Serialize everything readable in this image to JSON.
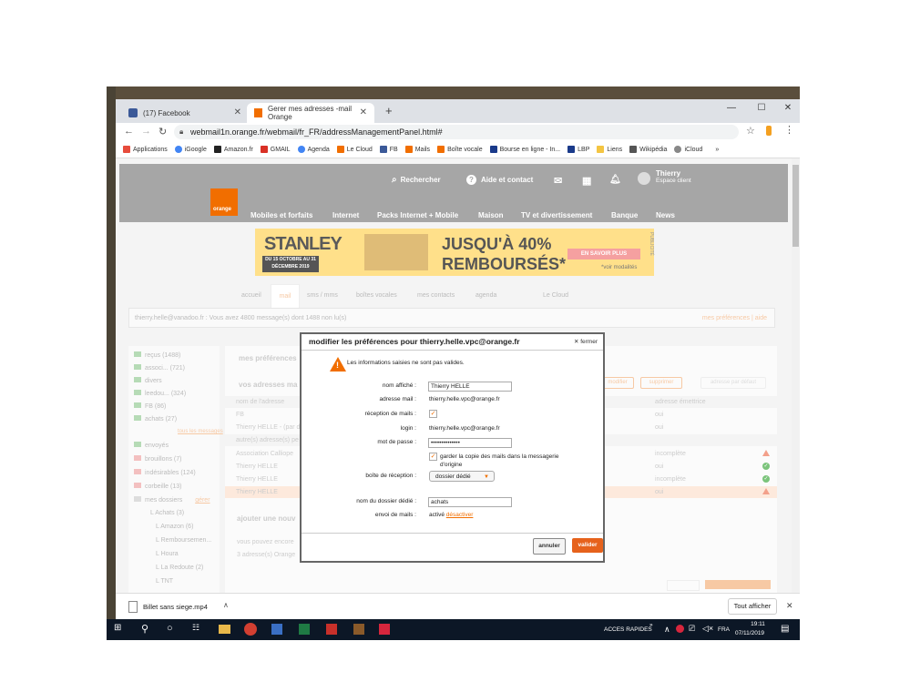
{
  "browser": {
    "tabs": [
      {
        "label": "(17) Facebook",
        "close": "✕"
      },
      {
        "label": "Gerer mes adresses -mail Orange",
        "close": "✕"
      }
    ],
    "new_tab": "+",
    "window": {
      "minimize": "—",
      "maximize": "☐",
      "close": "✕"
    },
    "url": "webmail1n.orange.fr/webmail/fr_FR/addressManagementPanel.html#",
    "bookmarks": [
      {
        "label": "Applications",
        "color": "#e74c3c"
      },
      {
        "label": "iGoogle",
        "color": "#4285f4"
      },
      {
        "label": "Amazon.fr",
        "color": "#222222"
      },
      {
        "label": "GMAIL",
        "color": "#d93025"
      },
      {
        "label": "Agenda",
        "color": "#4285f4"
      },
      {
        "label": "Le Cloud",
        "color": "#f16e00"
      },
      {
        "label": "FB",
        "color": "#3b5998"
      },
      {
        "label": "Mails",
        "color": "#f16e00"
      },
      {
        "label": "Boîte vocale",
        "color": "#f16e00"
      },
      {
        "label": "Bourse en ligne - In...",
        "color": "#1a3a8a"
      },
      {
        "label": "LBP",
        "color": "#1a3a8a"
      },
      {
        "label": "Liens",
        "color": "#f4c542"
      },
      {
        "label": "Wikipédia",
        "color": "#555555"
      },
      {
        "label": "iCloud",
        "color": "#888888"
      }
    ],
    "more_bookmarks": "»"
  },
  "header": {
    "search": "Rechercher",
    "help": "Aide et contact",
    "user_name": "Thierry",
    "user_sub": "Espace client",
    "logo": "orange",
    "nav": [
      "Mobiles et forfaits",
      "Internet",
      "Packs Internet + Mobile",
      "Maison",
      "TV et divertissement",
      "Banque",
      "News"
    ]
  },
  "banner": {
    "brand": "STANLEY",
    "dates": "DU 15 OCTOBRE AU 31 DÉCEMBRE 2019",
    "promo_line1": "JUSQU'À 40%",
    "promo_line2": "REMBOURSÉS*",
    "cta": "EN SAVOIR PLUS",
    "more": "*voir modalités",
    "pub": "PUBLICITÉ"
  },
  "mail_tabs": [
    "accueil",
    "mail",
    "sms / mms",
    "boîtes vocales",
    "mes contacts",
    "agenda",
    "Le Cloud"
  ],
  "info_bar": {
    "text": "thierry.helle@vanadoo.fr : Vous avez 4800 message(s) dont 1488 non lu(s)",
    "links": "mes préférences | aide"
  },
  "folders": [
    {
      "label": "reçus",
      "count": "(1488)"
    },
    {
      "label": "associ...",
      "count": "(721)"
    },
    {
      "label": "divers",
      "count": ""
    },
    {
      "label": "leedou...",
      "count": "(324)"
    },
    {
      "label": "FB",
      "count": "(86)"
    },
    {
      "label": "achats",
      "count": "(27)"
    },
    {
      "label": "tous les messages",
      "count": ""
    },
    {
      "label": "envoyés",
      "count": ""
    },
    {
      "label": "brouillons",
      "count": "(7)"
    },
    {
      "label": "indésirables",
      "count": "(124)"
    },
    {
      "label": "corbeille",
      "count": "(13)"
    },
    {
      "label": "mes dossiers",
      "count": "gérer"
    },
    {
      "label": "Achats",
      "count": "(3)"
    },
    {
      "label": "Amazon",
      "count": "(6)"
    },
    {
      "label": "Remboursemen...",
      "count": ""
    },
    {
      "label": "Houra",
      "count": ""
    },
    {
      "label": "La Redoute",
      "count": "(2)"
    },
    {
      "label": "TNT",
      "count": ""
    }
  ],
  "right_panel": {
    "title": "mes préférences",
    "section": "vos adresses ma",
    "col_name": "nom de l'adresse",
    "col_sender": "adresse émettrice",
    "btn_modify": "modifier",
    "btn_delete": "supprimer",
    "btn_default": "adresse par défaut",
    "rows": [
      {
        "name": "FB",
        "status": "oui"
      },
      {
        "name": "Thierry HELLE - (par d",
        "status": "oui"
      },
      {
        "name": "autre(s) adresse(s) pe",
        "status": ""
      },
      {
        "name": "Association Calliope",
        "status": "incomplète"
      },
      {
        "name": "Thierry HELLE",
        "status": "oui"
      },
      {
        "name": "Thierry HELLE",
        "status": "incomplète"
      },
      {
        "name": "Thierry HELLE",
        "status": "oui"
      }
    ],
    "add_title": "ajouter une nouv",
    "add_text1": "vous pouvez encore",
    "add_text2": "3 adresse(s) Orange"
  },
  "modal": {
    "title": "modifier les préférences pour thierry.helle.vpc@orange.fr",
    "close": "✕ fermer",
    "warning": "Les informations saisies ne sont pas valides.",
    "fields": {
      "display_name_label": "nom affiché :",
      "display_name_value": "Thierry HELLE",
      "email_label": "adresse mail :",
      "email_value": "thierry.helle.vpc@orange.fr",
      "reception_label": "réception de mails :",
      "login_label": "login :",
      "login_value": "thierry.helle.vpc@orange.fr",
      "password_label": "mot de passe :",
      "password_value": "••••••••••••••",
      "keep_copy_label": "garder la copie des mails dans la messagerie d'origine",
      "inbox_label": "boîte de réception :",
      "inbox_value": "dossier dédié",
      "folder_name_label": "nom du dossier dédié :",
      "folder_name_value": "achats",
      "send_label": "envoi de mails :",
      "send_value": "activé",
      "send_link": "désactiver"
    },
    "cancel": "annuler",
    "confirm": "valider"
  },
  "download_bar": {
    "file": "Billet sans siege.mp4",
    "show_all": "Tout afficher",
    "close": "✕"
  },
  "taskbar": {
    "quick_access": "ACCES RAPIDES",
    "lang": "FRA",
    "time": "19:11",
    "date": "07/11/2019"
  }
}
